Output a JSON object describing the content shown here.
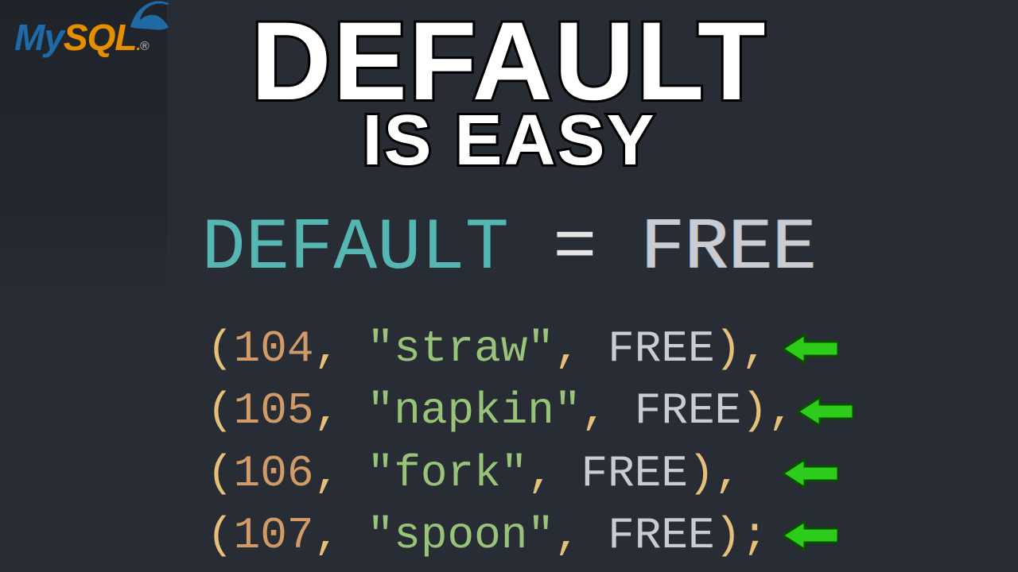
{
  "logo": {
    "part1": "My",
    "part2": "SQL",
    "dot": ".",
    "reg": "®"
  },
  "title": {
    "line1": "DEFAULT",
    "line2": "IS EASY"
  },
  "equation": {
    "keyword": "DEFAULT",
    "equals": "=",
    "value": "FREE"
  },
  "rows": [
    {
      "open": "(",
      "id": "104",
      "c1": ",",
      "q1": "\"",
      "name": "straw",
      "q2": "\"",
      "c2": ",",
      "val": "FREE",
      "close": ")",
      "term": ","
    },
    {
      "open": "(",
      "id": "105",
      "c1": ",",
      "q1": "\"",
      "name": "napkin",
      "q2": "\"",
      "c2": ",",
      "val": "FREE",
      "close": ")",
      "term": ","
    },
    {
      "open": "(",
      "id": "106",
      "c1": ",",
      "q1": "\"",
      "name": "fork",
      "q2": "\"",
      "c2": ",",
      "val": "FREE",
      "close": ")",
      "term": ","
    },
    {
      "open": "(",
      "id": "107",
      "c1": ",",
      "q1": "\"",
      "name": "spoon",
      "q2": "\"",
      "c2": ",",
      "val": "FREE",
      "close": ")",
      "term": ";"
    }
  ],
  "arrow_positions_x": [
    990,
    1050,
    990,
    1050
  ]
}
